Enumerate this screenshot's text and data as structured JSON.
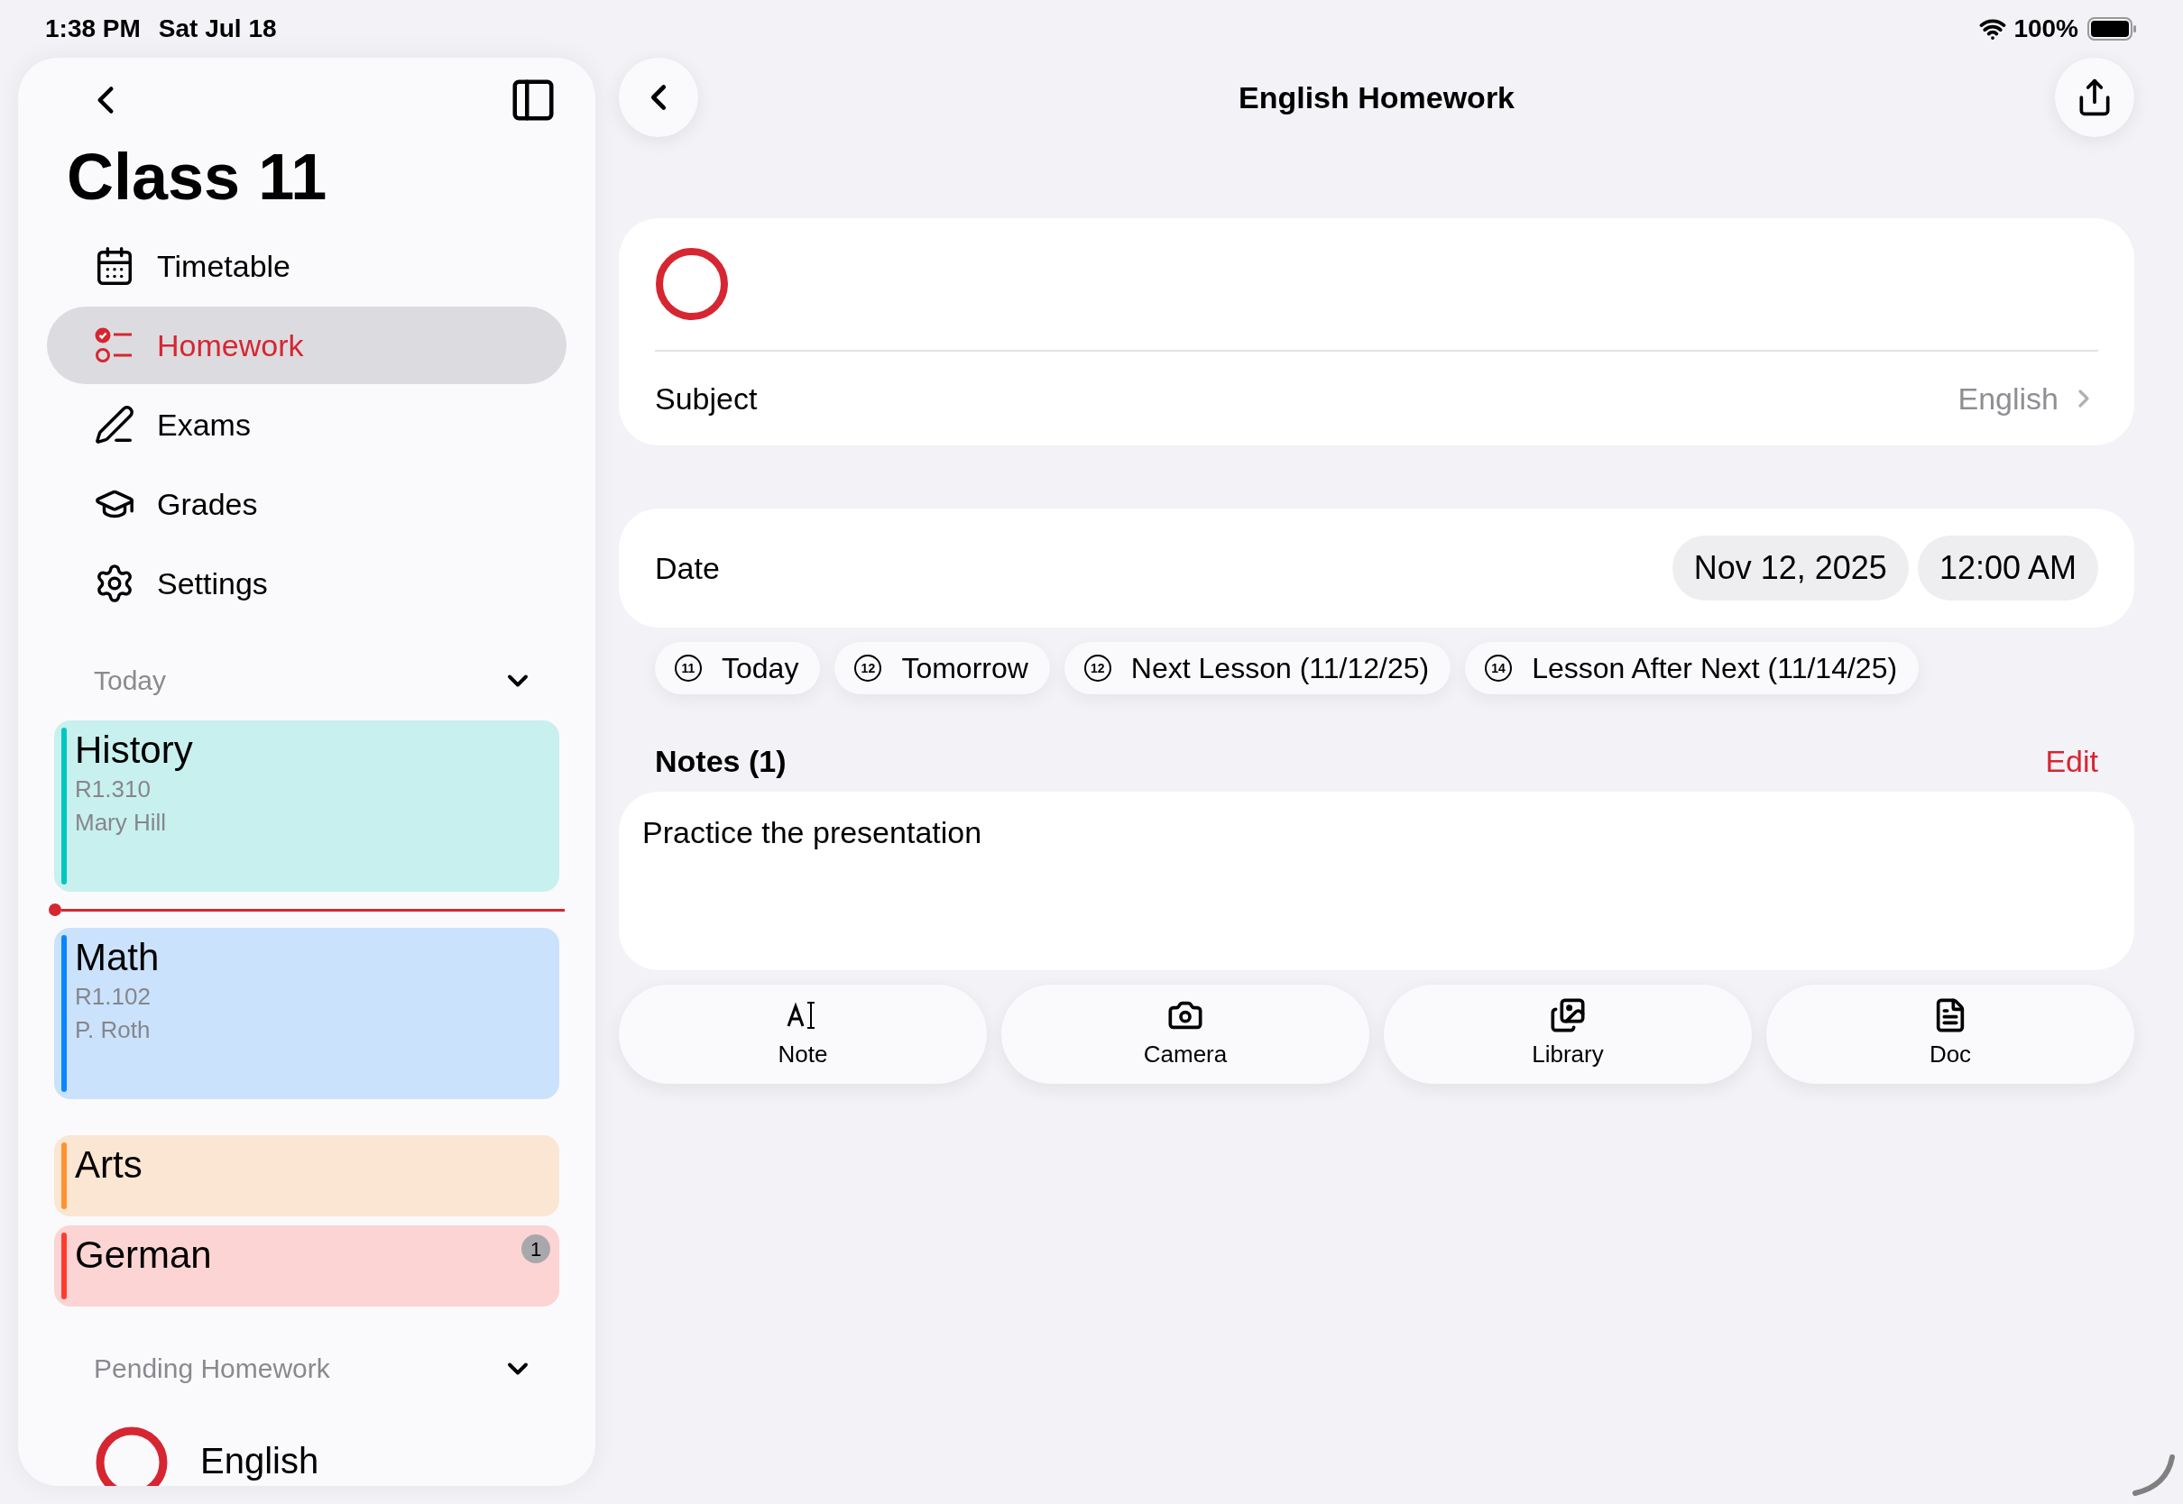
{
  "status_bar": {
    "time": "1:38 PM",
    "date": "Sat Jul 18",
    "battery": "100%"
  },
  "sidebar": {
    "title": "Class 11",
    "nav": [
      {
        "label": "Timetable",
        "selected": false
      },
      {
        "label": "Homework",
        "selected": true
      },
      {
        "label": "Exams",
        "selected": false
      },
      {
        "label": "Grades",
        "selected": false
      },
      {
        "label": "Settings",
        "selected": false
      }
    ],
    "today": {
      "title": "Today",
      "lessons": [
        {
          "subject": "History",
          "room": "R1.310",
          "teacher": "Mary Hill",
          "color": "#00c7be"
        },
        {
          "subject": "Math",
          "room": "R1.102",
          "teacher": "P. Roth",
          "color": "#0a84ff"
        },
        {
          "subject": "Arts",
          "color": "#ff9230"
        },
        {
          "subject": "German",
          "color": "#ff3b30",
          "badge": "1"
        }
      ]
    },
    "pending": {
      "title": "Pending Homework",
      "items": [
        {
          "title": "English"
        }
      ]
    }
  },
  "main": {
    "title": "English Homework",
    "completed": false,
    "subject": {
      "label": "Subject",
      "value": "English"
    },
    "date": {
      "label": "Date",
      "date": "Nov 12, 2025",
      "time": "12:00 AM"
    },
    "quick_dates": [
      {
        "day": "11",
        "label": "Today"
      },
      {
        "day": "12",
        "label": "Tomorrow"
      },
      {
        "day": "12",
        "label": "Next Lesson (11/12/25)"
      },
      {
        "day": "14",
        "label": "Lesson After Next (11/14/25)"
      }
    ],
    "notes": {
      "title": "Notes (1)",
      "edit": "Edit",
      "items": [
        "Practice the presentation"
      ]
    },
    "attachments": [
      {
        "kind": "note",
        "label": "Note"
      },
      {
        "kind": "camera",
        "label": "Camera"
      },
      {
        "kind": "library",
        "label": "Library"
      },
      {
        "kind": "doc",
        "label": "Doc"
      }
    ]
  }
}
